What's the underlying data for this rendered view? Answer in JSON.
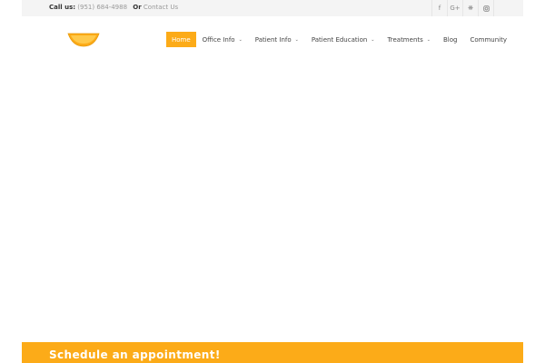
{
  "topbar": {
    "call_label": "Call us:",
    "phone": "(951) 684-4988",
    "or_label": "Or",
    "contact_link": "Contact Us"
  },
  "social_icons": [
    "facebook-icon",
    "google-plus-icon",
    "yelp-icon",
    "instagram-icon"
  ],
  "nav": {
    "items": [
      {
        "label": "Home",
        "active": true,
        "dropdown": false
      },
      {
        "label": "Office Info",
        "active": false,
        "dropdown": true
      },
      {
        "label": "Patient Info",
        "active": false,
        "dropdown": true
      },
      {
        "label": "Patient Education",
        "active": false,
        "dropdown": true
      },
      {
        "label": "Treatments",
        "active": false,
        "dropdown": true
      },
      {
        "label": "Blog",
        "active": false,
        "dropdown": false
      },
      {
        "label": "Community",
        "active": false,
        "dropdown": false
      }
    ]
  },
  "banner": {
    "title": "Schedule an appointment!"
  },
  "colors": {
    "accent": "#fcab18",
    "topbar_bg": "#f4f4f4"
  }
}
